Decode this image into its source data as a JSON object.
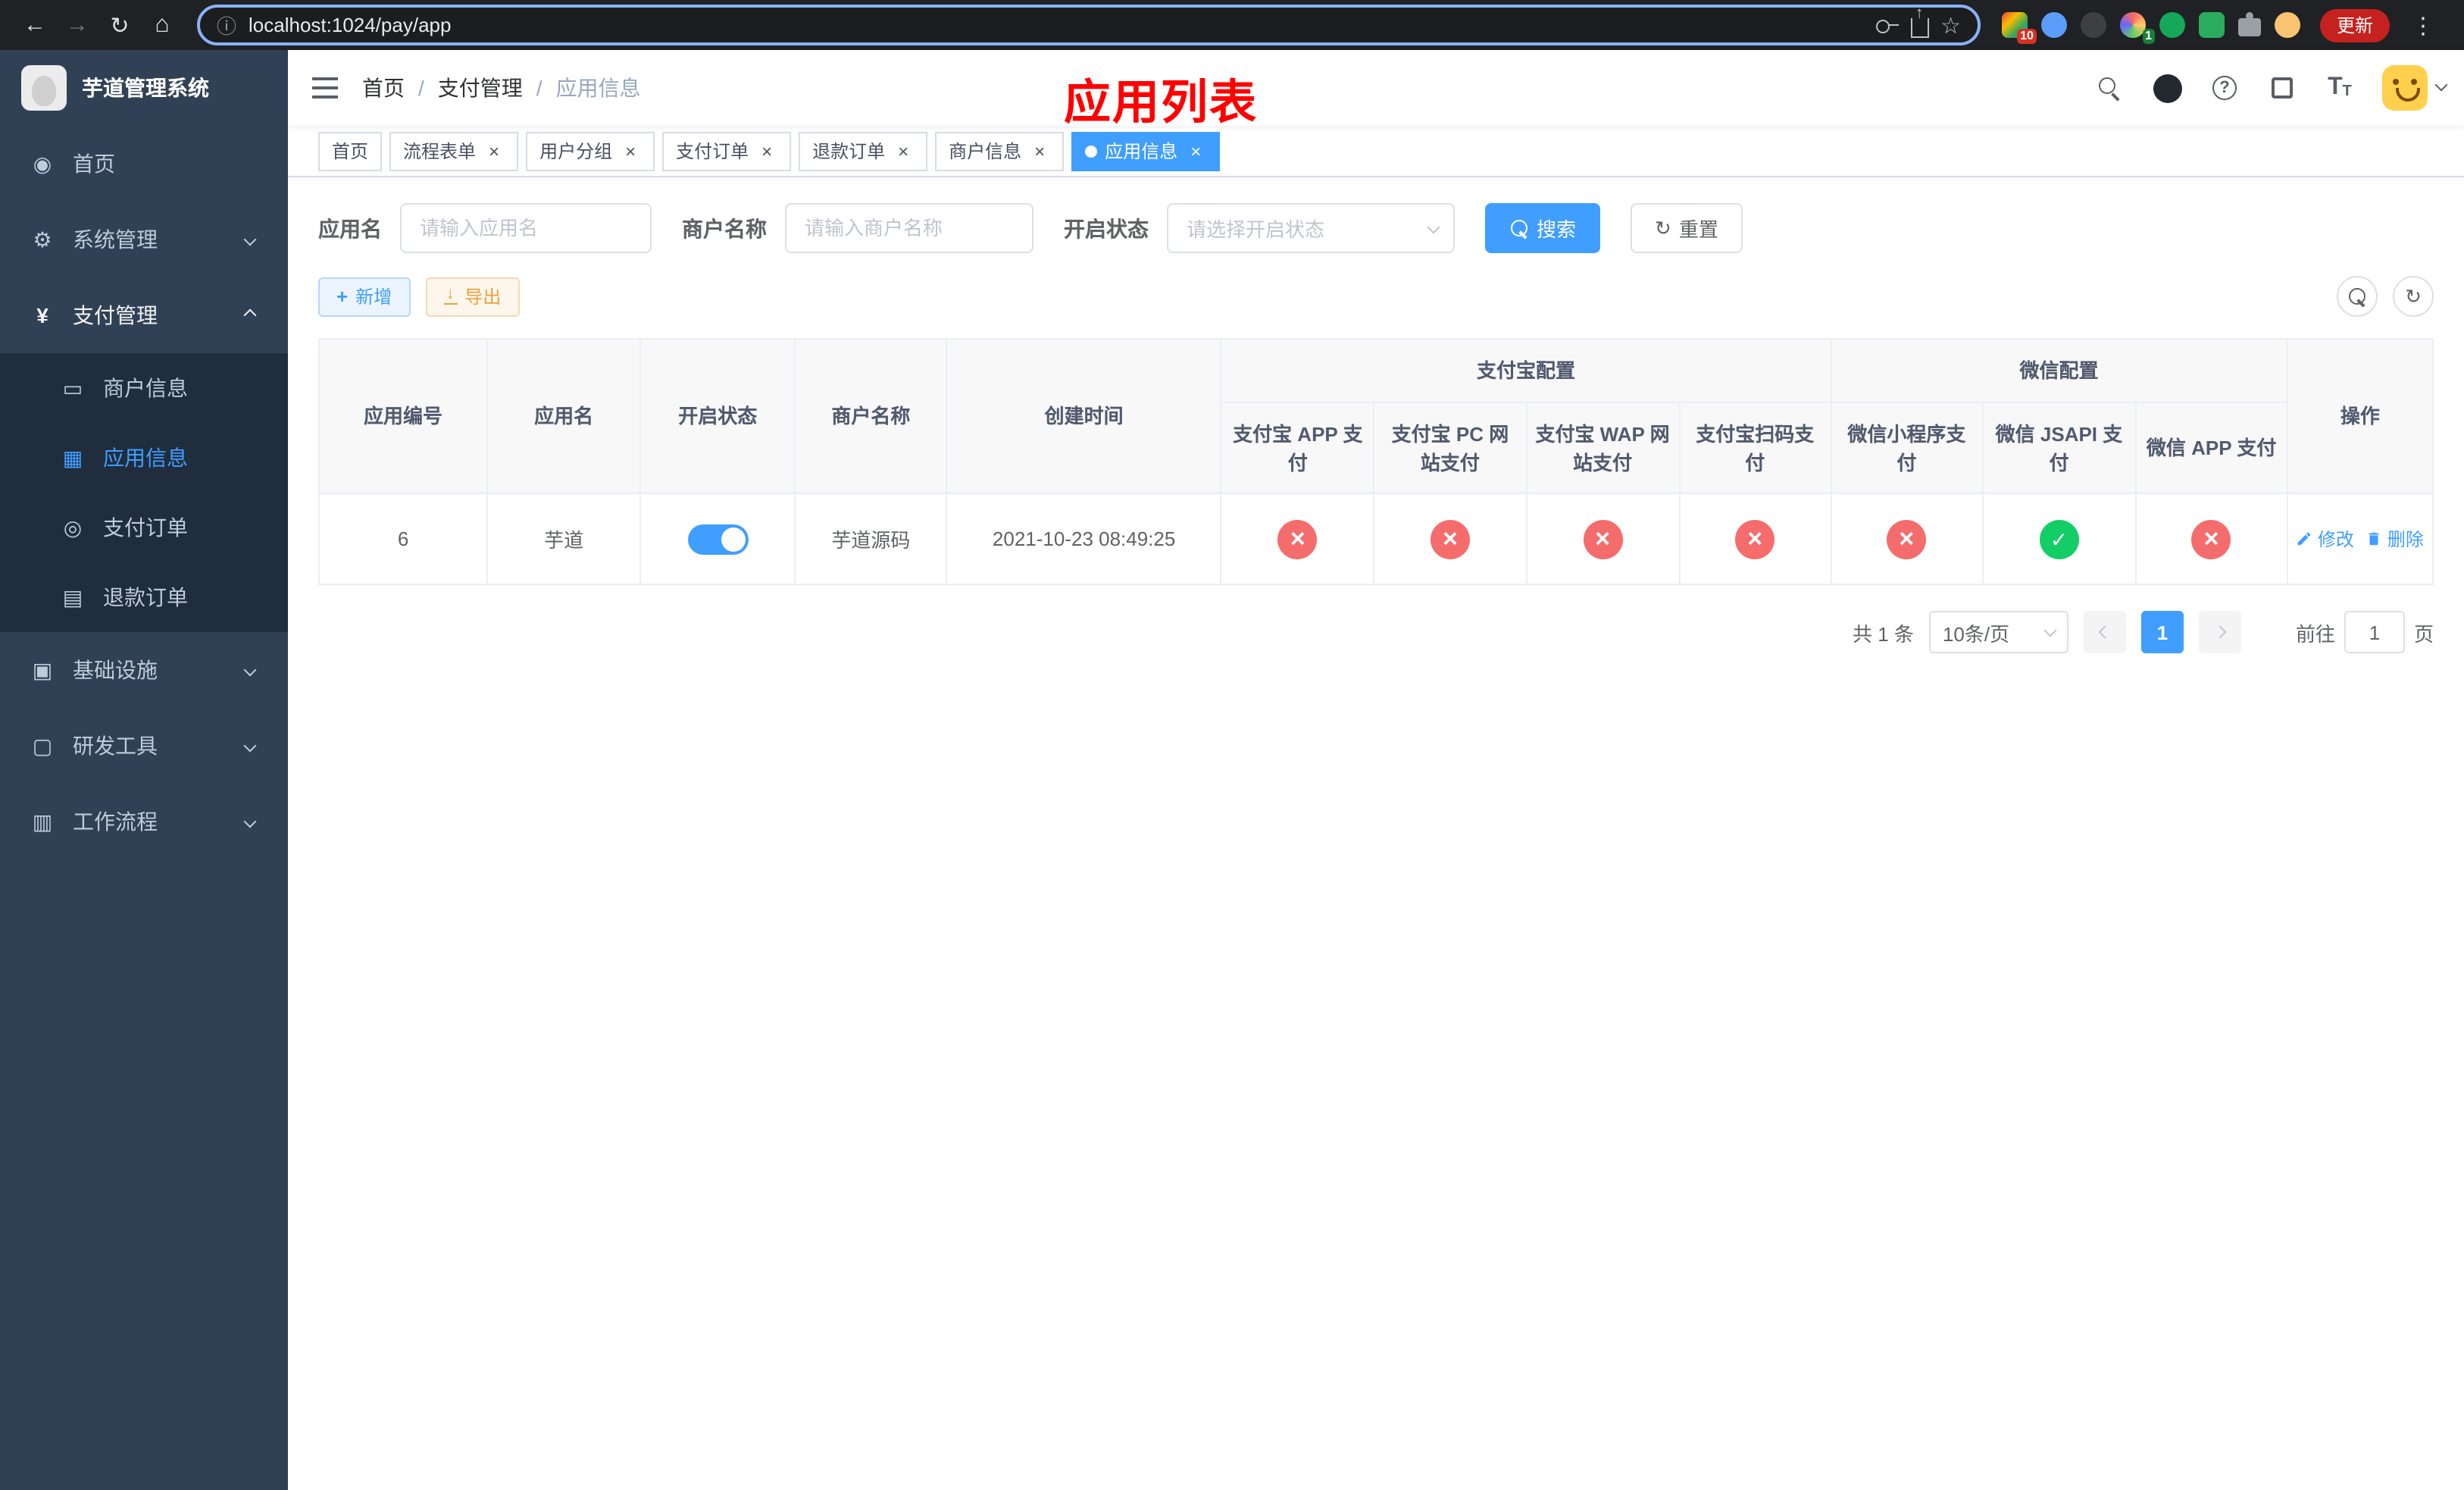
{
  "browser": {
    "url": "localhost:1024/pay/app",
    "update_button_label": "更新",
    "extension_badge_1": "10",
    "extension_badge_2": "1"
  },
  "annotation": {
    "text": "应用列表"
  },
  "sidebar": {
    "app_title": "芋道管理系统",
    "items": [
      {
        "label": "首页"
      },
      {
        "label": "系统管理"
      },
      {
        "label": "支付管理",
        "children": [
          {
            "label": "商户信息"
          },
          {
            "label": "应用信息"
          },
          {
            "label": "支付订单"
          },
          {
            "label": "退款订单"
          }
        ]
      },
      {
        "label": "基础设施"
      },
      {
        "label": "研发工具"
      },
      {
        "label": "工作流程"
      }
    ]
  },
  "breadcrumb": [
    "首页",
    "支付管理",
    "应用信息"
  ],
  "tabs": [
    {
      "label": "首页"
    },
    {
      "label": "流程表单"
    },
    {
      "label": "用户分组"
    },
    {
      "label": "支付订单"
    },
    {
      "label": "退款订单"
    },
    {
      "label": "商户信息"
    },
    {
      "label": "应用信息"
    }
  ],
  "filters": {
    "app_name_label": "应用名",
    "app_name_placeholder": "请输入应用名",
    "merchant_label": "商户名称",
    "merchant_placeholder": "请输入商户名称",
    "status_label": "开启状态",
    "status_placeholder": "请选择开启状态",
    "search_label": "搜索",
    "reset_label": "重置"
  },
  "toolbar": {
    "add_label": "新增",
    "export_label": "导出"
  },
  "table": {
    "columns": [
      "应用编号",
      "应用名",
      "开启状态",
      "商户名称",
      "创建时间"
    ],
    "groups": [
      "支付宝配置",
      "微信配置"
    ],
    "sub_columns": [
      "支付宝 APP 支付",
      "支付宝 PC 网站支付",
      "支付宝 WAP 网站支付",
      "支付宝扫码支付",
      "微信小程序支付",
      "微信 JSAPI 支付",
      "微信 APP 支付"
    ],
    "actions_column": "操作",
    "rows": [
      {
        "id": "6",
        "name": "芋道",
        "enabled": "true",
        "merchant": "芋道源码",
        "created": "2021-10-23 08:49:25",
        "configs": [
          "no",
          "no",
          "no",
          "no",
          "no",
          "yes",
          "no"
        ],
        "edit_label": "修改",
        "delete_label": "删除"
      }
    ]
  },
  "pagination": {
    "total_text": "共 1 条",
    "page_size_text": "10条/页",
    "page": "1",
    "goto_prefix": "前往",
    "goto_value": "1",
    "goto_suffix": "页"
  },
  "colors": {
    "primary": "#409eff",
    "success": "#13ce66",
    "danger": "#f56c6c",
    "warning": "#e6a23c",
    "annotation_red": "#ff0000",
    "sidebar_bg": "#304156",
    "submenu_bg": "#1f2d3d"
  }
}
